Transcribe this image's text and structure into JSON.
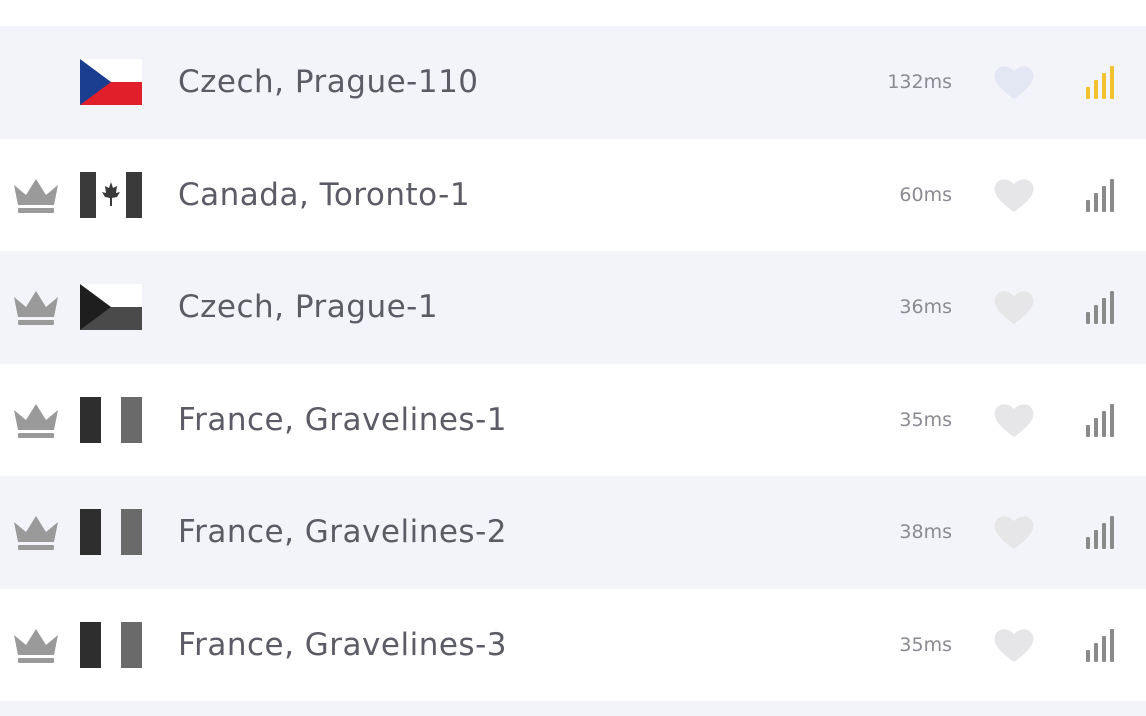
{
  "colors": {
    "row_shade": "#f3f4fa",
    "row_plain": "#ffffff",
    "text": "#5c5c66",
    "ping_text": "#8a8a92",
    "crown": "#9a9a9a",
    "heart_inactive": "#e6e6e8",
    "heart_selected": "#e3e6f3",
    "signal_gray": "#8a8a8a",
    "signal_active": "#f2c230"
  },
  "servers": [
    {
      "name": "Czech, Prague-110",
      "ping": "132ms",
      "premium": false,
      "flag": "czech-color",
      "selected": true,
      "signal_icon": "signal-strength-icon"
    },
    {
      "name": "Canada, Toronto-1",
      "ping": "60ms",
      "premium": true,
      "flag": "canada",
      "selected": false,
      "signal_icon": "signal-strength-icon"
    },
    {
      "name": "Czech, Prague-1",
      "ping": "36ms",
      "premium": true,
      "flag": "czech",
      "selected": false,
      "signal_icon": "signal-strength-icon"
    },
    {
      "name": "France, Gravelines-1",
      "ping": "35ms",
      "premium": true,
      "flag": "france",
      "selected": false,
      "signal_icon": "signal-strength-icon"
    },
    {
      "name": "France, Gravelines-2",
      "ping": "38ms",
      "premium": true,
      "flag": "france",
      "selected": false,
      "signal_icon": "signal-strength-icon"
    },
    {
      "name": "France, Gravelines-3",
      "ping": "35ms",
      "premium": true,
      "flag": "france",
      "selected": false,
      "signal_icon": "signal-strength-icon"
    }
  ]
}
